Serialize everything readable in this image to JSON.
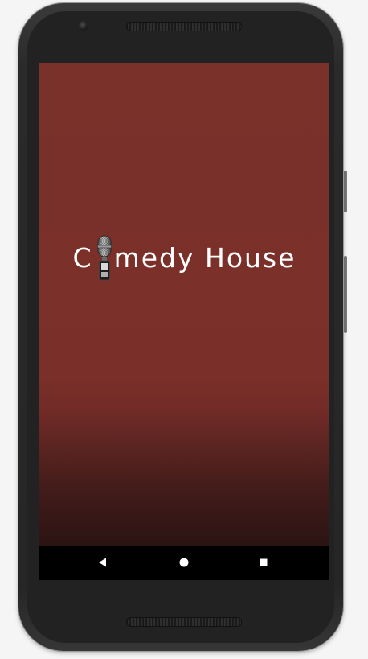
{
  "app": {
    "name_before_mic": "C",
    "name_after_mic": "medy House"
  },
  "colors": {
    "splash_background": "#7a312a",
    "logo_text": "#ffffff",
    "nav_bar": "#000000",
    "phone_body": "#262626"
  },
  "icons": {
    "logo_mic": "microphone-icon",
    "back": "back-triangle-icon",
    "home": "home-circle-icon",
    "recents": "recents-square-icon"
  }
}
